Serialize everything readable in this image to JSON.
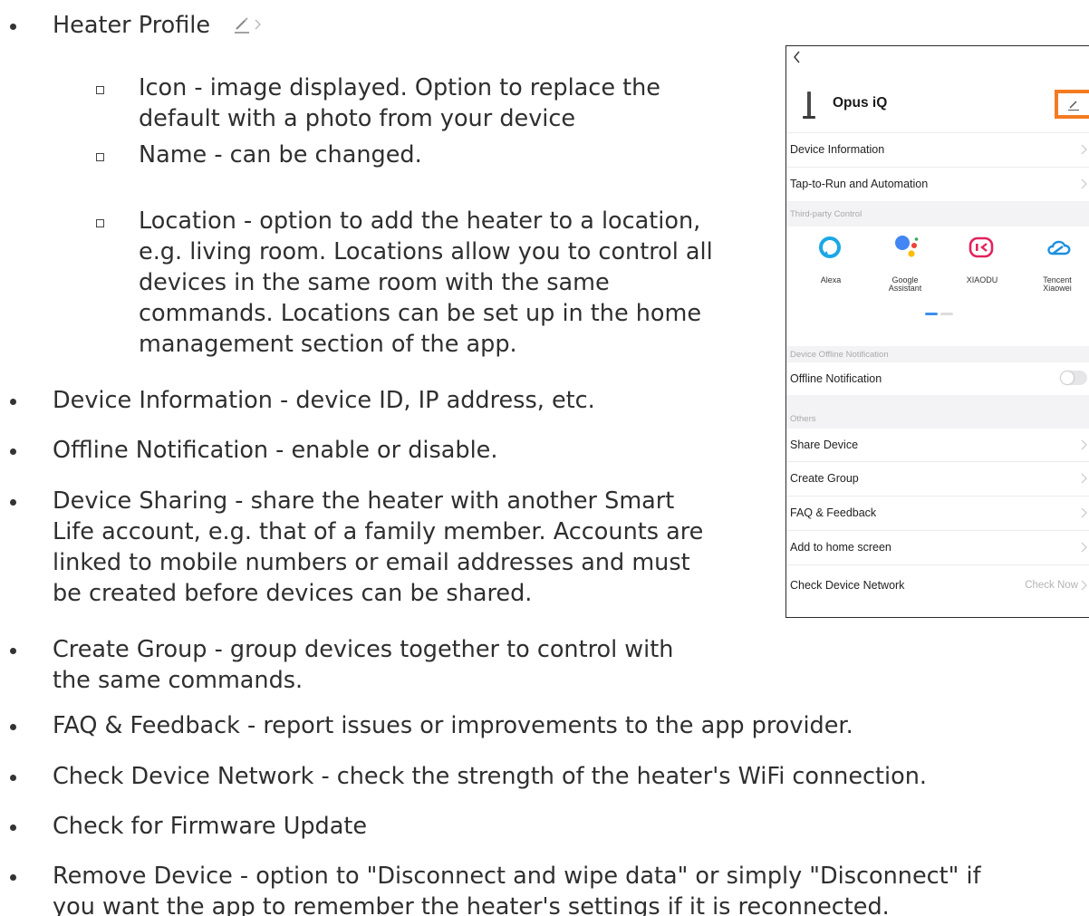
{
  "document": {
    "heading": "Heater Profile",
    "sub_items": [
      {
        "lines": [
          "Icon - image displayed. Option to replace the",
          "default with a photo from your device"
        ]
      },
      {
        "lines": [
          "Name - can be changed."
        ]
      },
      {
        "lines": [
          "Location - option to add the heater to a location,",
          "e.g. living room. Locations allow you to control all",
          "devices in the same room with the same",
          "commands. Locations can be set up in the home",
          "management section of the app."
        ]
      }
    ],
    "items": [
      {
        "lines": [
          "Device Information - device ID, IP address, etc."
        ]
      },
      {
        "lines": [
          "Offline Notification - enable or disable."
        ]
      },
      {
        "lines": [
          "Device Sharing - share the heater with another Smart",
          "Life account, e.g. that of a family member. Accounts are",
          "linked to mobile numbers or email addresses and must",
          "be created before devices can be shared."
        ]
      },
      {
        "lines": [
          "Create Group - group devices together to control with",
          "the same commands."
        ]
      },
      {
        "lines": [
          "FAQ & Feedback - report issues or improvements to the app provider."
        ]
      },
      {
        "lines": [
          "Check Device Network - check the strength of the heater's WiFi connection."
        ]
      },
      {
        "lines": [
          "Check for Firmware Update"
        ]
      },
      {
        "lines": [
          "Remove Device - option to \"Disconnect and wipe data\" or simply \"Disconnect\" if",
          "you want the app to remember the heater's settings if it is reconnected."
        ]
      }
    ],
    "heading_icons": [
      "pencil-icon",
      "chevron-right-icon"
    ]
  },
  "phone": {
    "back_icon": "chevron-left-icon",
    "device_name": "Opus iQ",
    "edit_icon": "pencil-icon",
    "highlight_color": "#f47b20",
    "rows_top": [
      {
        "label": "Device Information"
      },
      {
        "label": "Tap-to-Run and Automation"
      }
    ],
    "third_party_header": "Third-party Control",
    "controls": [
      {
        "name": "Alexa",
        "icon": "alexa-icon",
        "color": "#1aa7e6"
      },
      {
        "name": "Google Assistant",
        "icon": "google-assistant-icon",
        "color": "#4285f4"
      },
      {
        "name": "XIAODU",
        "icon": "xiaodu-icon",
        "color": "#e2245c"
      },
      {
        "name": "Tencent Xiaowei",
        "icon": "tencent-xiaowei-icon",
        "color": "#1c8fe0"
      }
    ],
    "google_label_lines": [
      "Google",
      "Assistant"
    ],
    "tencent_label_lines": [
      "Tencent",
      "Xiaowei"
    ],
    "offline_header": "Device Offline Notification",
    "offline_label": "Offline Notification",
    "offline_enabled": false,
    "others_header": "Others",
    "rows_others": [
      {
        "label": "Share Device"
      },
      {
        "label": "Create Group"
      },
      {
        "label": "FAQ & Feedback"
      },
      {
        "label": "Add to home screen"
      }
    ],
    "network_label": "Check Device Network",
    "network_action": "Check Now"
  }
}
